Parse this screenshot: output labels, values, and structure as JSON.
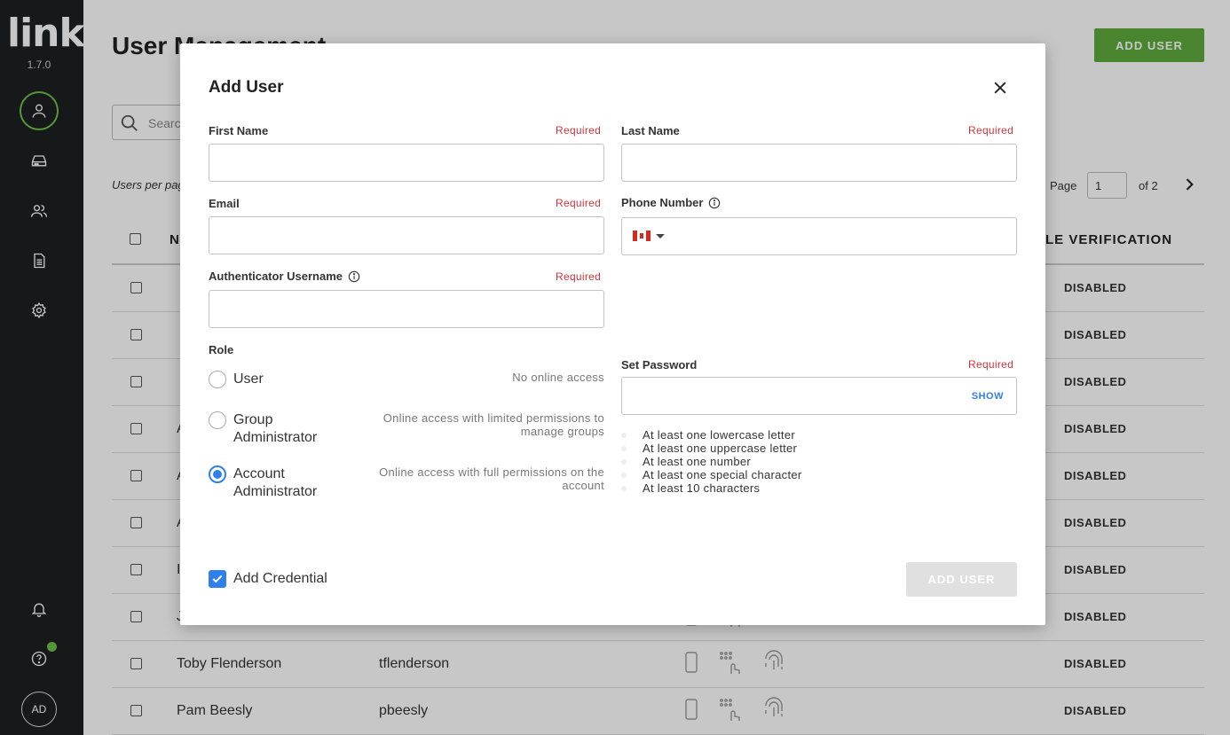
{
  "app": {
    "logo": "link",
    "version": "1.7.0",
    "avatar_initials": "AD"
  },
  "sidebar": {
    "items": [
      {
        "icon": "user-icon",
        "active": true
      },
      {
        "icon": "device-icon",
        "active": false
      },
      {
        "icon": "users-icon",
        "active": false
      },
      {
        "icon": "document-icon",
        "active": false
      },
      {
        "icon": "gear-icon",
        "active": false
      },
      {
        "icon": "bell-icon",
        "active": false
      },
      {
        "icon": "help-icon",
        "active": false
      }
    ]
  },
  "page": {
    "title": "User Management",
    "add_user_label": "ADD USER",
    "search_placeholder": "Search",
    "per_page_label": "Users per page",
    "pager": {
      "page_label": "Page",
      "current": "1",
      "of_label": "of 2"
    },
    "columns": {
      "name": "N",
      "verification": "LE VERIFICATION"
    },
    "rows": [
      {
        "name": "",
        "username": "",
        "status": "DISABLED"
      },
      {
        "name": "",
        "username": "",
        "status": "DISABLED"
      },
      {
        "name": "",
        "username": "",
        "status": "DISABLED"
      },
      {
        "name": "A",
        "username": "",
        "status": "DISABLED"
      },
      {
        "name": "A",
        "username": "",
        "status": "DISABLED"
      },
      {
        "name": "A",
        "username": "",
        "status": "DISABLED"
      },
      {
        "name": "I",
        "username": "",
        "status": "DISABLED"
      },
      {
        "name": "J",
        "username": "",
        "status": "DISABLED"
      },
      {
        "name": "Toby Flenderson",
        "username": "tflenderson",
        "status": "DISABLED"
      },
      {
        "name": "Pam Beesly",
        "username": "pbeesly",
        "status": "DISABLED"
      }
    ]
  },
  "modal": {
    "title": "Add User",
    "required_label": "Required",
    "first_name": {
      "label": "First Name",
      "value": ""
    },
    "last_name": {
      "label": "Last Name",
      "value": ""
    },
    "email": {
      "label": "Email",
      "value": ""
    },
    "phone": {
      "label": "Phone Number",
      "country": "CA",
      "value": ""
    },
    "auth_username": {
      "label": "Authenticator Username",
      "value": ""
    },
    "role": {
      "label": "Role",
      "options": [
        {
          "label": "User",
          "desc": "No online access",
          "checked": false
        },
        {
          "label": "Group Administrator",
          "desc": "Online access with limited permissions to manage groups",
          "checked": false
        },
        {
          "label": "Account Administrator",
          "desc": "Online access with full permissions on the account",
          "checked": true
        }
      ]
    },
    "password": {
      "label": "Set Password",
      "show_label": "SHOW",
      "rules": [
        "At least one lowercase letter",
        "At least one uppercase letter",
        "At least one number",
        "At least one special character",
        "At least 10 characters"
      ]
    },
    "add_credential": {
      "label": "Add Credential",
      "checked": true
    },
    "submit_label": "ADD USER"
  }
}
